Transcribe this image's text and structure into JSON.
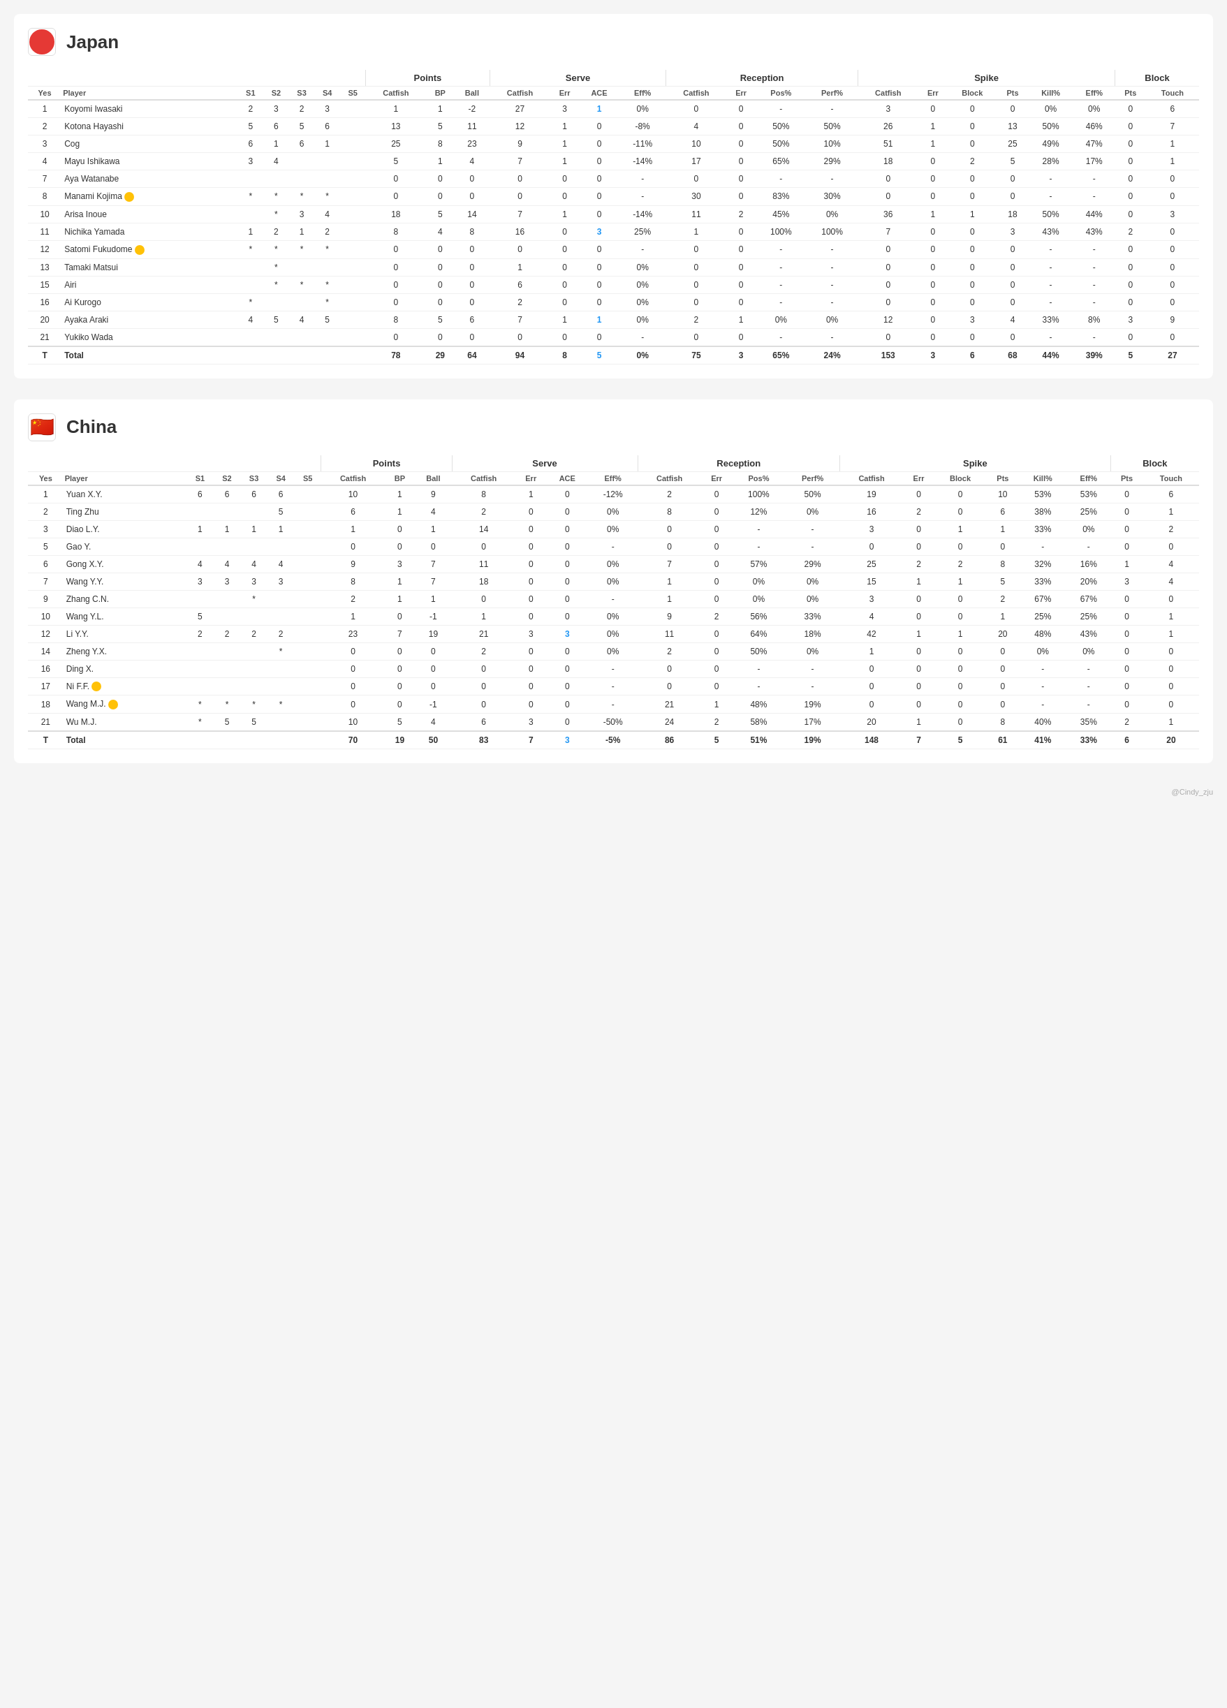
{
  "japan": {
    "name": "Japan",
    "flag": "japan",
    "columns": {
      "yes": "Yes",
      "player": "Player",
      "s1": "S1",
      "s2": "S2",
      "s3": "S3",
      "s4": "S4",
      "s5": "S5",
      "points_catfish": "Catfish",
      "points_bp": "BP",
      "points_ball": "Ball",
      "serve_catfish": "Catfish",
      "serve_err": "Err",
      "serve_ace": "ACE",
      "serve_eff": "Eff%",
      "reception_catfish": "Catfish",
      "reception_err": "Err",
      "reception_pos": "Pos%",
      "reception_perf": "Perf%",
      "spike_catfish": "Catfish",
      "spike_err": "Err",
      "spike_block": "Block",
      "spike_pts": "Pts",
      "spike_kill": "Kill%",
      "spike_eff": "Eff%",
      "block_pts": "Pts",
      "block_touch": "Touch"
    },
    "group_labels": {
      "points": "Points",
      "serve": "Serve",
      "reception": "Reception",
      "spike": "Spike",
      "block": "Block"
    },
    "players": [
      {
        "yes": "1",
        "player": "Koyomi Iwasaki",
        "badge": "",
        "s1": "2",
        "s2": "3",
        "s3": "2",
        "s4": "3",
        "s5": "",
        "pc": "1",
        "bp": "1",
        "ball": "-2",
        "sc": "27",
        "se": "3",
        "ace": "1",
        "seff": "0%",
        "rc": "0",
        "re": "0",
        "rpos": "-",
        "rperf": "-",
        "spc": "3",
        "spe": "0",
        "spblock": "0",
        "sppts": "0",
        "spkill": "0%",
        "speff": "0%",
        "bpts": "0",
        "btouch": "6"
      },
      {
        "yes": "2",
        "player": "Kotona Hayashi",
        "badge": "",
        "s1": "5",
        "s2": "6",
        "s3": "5",
        "s4": "6",
        "s5": "",
        "pc": "13",
        "bp": "5",
        "ball": "11",
        "sc": "12",
        "se": "1",
        "ace": "0",
        "seff": "-8%",
        "rc": "4",
        "re": "0",
        "rpos": "50%",
        "rperf": "50%",
        "spc": "26",
        "spe": "1",
        "spblock": "0",
        "sppts": "13",
        "spkill": "50%",
        "speff": "46%",
        "bpts": "0",
        "btouch": "7"
      },
      {
        "yes": "3",
        "player": "Cog",
        "badge": "",
        "s1": "6",
        "s2": "1",
        "s3": "6",
        "s4": "1",
        "s5": "",
        "pc": "25",
        "bp": "8",
        "ball": "23",
        "sc": "9",
        "se": "1",
        "ace": "0",
        "seff": "-11%",
        "rc": "10",
        "re": "0",
        "rpos": "50%",
        "rperf": "10%",
        "spc": "51",
        "spe": "1",
        "spblock": "0",
        "sppts": "25",
        "spkill": "49%",
        "speff": "47%",
        "bpts": "0",
        "btouch": "1"
      },
      {
        "yes": "4",
        "player": "Mayu Ishikawa",
        "badge": "",
        "s1": "3",
        "s2": "4",
        "s3": "",
        "s4": "",
        "s5": "",
        "pc": "5",
        "bp": "1",
        "ball": "4",
        "sc": "7",
        "se": "1",
        "ace": "0",
        "seff": "-14%",
        "rc": "17",
        "re": "0",
        "rpos": "65%",
        "rperf": "29%",
        "spc": "18",
        "spe": "0",
        "spblock": "2",
        "sppts": "5",
        "spkill": "28%",
        "speff": "17%",
        "bpts": "0",
        "btouch": "1"
      },
      {
        "yes": "7",
        "player": "Aya Watanabe",
        "badge": "",
        "s1": "",
        "s2": "",
        "s3": "",
        "s4": "",
        "s5": "",
        "pc": "0",
        "bp": "0",
        "ball": "0",
        "sc": "0",
        "se": "0",
        "ace": "0",
        "seff": "-",
        "rc": "0",
        "re": "0",
        "rpos": "-",
        "rperf": "-",
        "spc": "0",
        "spe": "0",
        "spblock": "0",
        "sppts": "0",
        "spkill": "-",
        "speff": "-",
        "bpts": "0",
        "btouch": "0"
      },
      {
        "yes": "8",
        "player": "Manami Kojima",
        "badge": "L",
        "s1": "*",
        "s2": "*",
        "s3": "*",
        "s4": "*",
        "s5": "",
        "pc": "0",
        "bp": "0",
        "ball": "0",
        "sc": "0",
        "se": "0",
        "ace": "0",
        "seff": "-",
        "rc": "30",
        "re": "0",
        "rpos": "83%",
        "rperf": "30%",
        "spc": "0",
        "spe": "0",
        "spblock": "0",
        "sppts": "0",
        "spkill": "-",
        "speff": "-",
        "bpts": "0",
        "btouch": "0"
      },
      {
        "yes": "10",
        "player": "Arisa Inoue",
        "badge": "",
        "s1": "",
        "s2": "*",
        "s3": "3",
        "s4": "4",
        "s5": "",
        "pc": "18",
        "bp": "5",
        "ball": "14",
        "sc": "7",
        "se": "1",
        "ace": "0",
        "seff": "-14%",
        "rc": "11",
        "re": "2",
        "rpos": "45%",
        "rperf": "0%",
        "spc": "36",
        "spe": "1",
        "spblock": "1",
        "sppts": "18",
        "spkill": "50%",
        "speff": "44%",
        "bpts": "0",
        "btouch": "3"
      },
      {
        "yes": "11",
        "player": "Nichika Yamada",
        "badge": "",
        "s1": "1",
        "s2": "2",
        "s3": "1",
        "s4": "2",
        "s5": "",
        "pc": "8",
        "bp": "4",
        "ball": "8",
        "sc": "16",
        "se": "0",
        "ace": "3",
        "seff": "25%",
        "rc": "1",
        "re": "0",
        "rpos": "100%",
        "rperf": "100%",
        "spc": "7",
        "spe": "0",
        "spblock": "0",
        "sppts": "3",
        "spkill": "43%",
        "speff": "43%",
        "bpts": "2",
        "btouch": "0"
      },
      {
        "yes": "12",
        "player": "Satomi Fukudome",
        "badge": "L",
        "s1": "*",
        "s2": "*",
        "s3": "*",
        "s4": "*",
        "s5": "",
        "pc": "0",
        "bp": "0",
        "ball": "0",
        "sc": "0",
        "se": "0",
        "ace": "0",
        "seff": "-",
        "rc": "0",
        "re": "0",
        "rpos": "-",
        "rperf": "-",
        "spc": "0",
        "spe": "0",
        "spblock": "0",
        "sppts": "0",
        "spkill": "-",
        "speff": "-",
        "bpts": "0",
        "btouch": "0"
      },
      {
        "yes": "13",
        "player": "Tamaki Matsui",
        "badge": "",
        "s1": "",
        "s2": "*",
        "s3": "",
        "s4": "",
        "s5": "",
        "pc": "0",
        "bp": "0",
        "ball": "0",
        "sc": "1",
        "se": "0",
        "ace": "0",
        "seff": "0%",
        "rc": "0",
        "re": "0",
        "rpos": "-",
        "rperf": "-",
        "spc": "0",
        "spe": "0",
        "spblock": "0",
        "sppts": "0",
        "spkill": "-",
        "speff": "-",
        "bpts": "0",
        "btouch": "0"
      },
      {
        "yes": "15",
        "player": "Airi",
        "badge": "",
        "s1": "",
        "s2": "*",
        "s3": "*",
        "s4": "*",
        "s5": "",
        "pc": "0",
        "bp": "0",
        "ball": "0",
        "sc": "6",
        "se": "0",
        "ace": "0",
        "seff": "0%",
        "rc": "0",
        "re": "0",
        "rpos": "-",
        "rperf": "-",
        "spc": "0",
        "spe": "0",
        "spblock": "0",
        "sppts": "0",
        "spkill": "-",
        "speff": "-",
        "bpts": "0",
        "btouch": "0"
      },
      {
        "yes": "16",
        "player": "Ai Kurogo",
        "badge": "",
        "s1": "*",
        "s2": "",
        "s3": "",
        "s4": "*",
        "s5": "",
        "pc": "0",
        "bp": "0",
        "ball": "0",
        "sc": "2",
        "se": "0",
        "ace": "0",
        "seff": "0%",
        "rc": "0",
        "re": "0",
        "rpos": "-",
        "rperf": "-",
        "spc": "0",
        "spe": "0",
        "spblock": "0",
        "sppts": "0",
        "spkill": "-",
        "speff": "-",
        "bpts": "0",
        "btouch": "0"
      },
      {
        "yes": "20",
        "player": "Ayaka Araki",
        "badge": "",
        "s1": "4",
        "s2": "5",
        "s3": "4",
        "s4": "5",
        "s5": "",
        "pc": "8",
        "bp": "5",
        "ball": "6",
        "sc": "7",
        "se": "1",
        "ace": "1",
        "seff": "0%",
        "rc": "2",
        "re": "1",
        "rpos": "0%",
        "rperf": "0%",
        "spc": "12",
        "spe": "0",
        "spblock": "3",
        "sppts": "4",
        "spkill": "33%",
        "speff": "8%",
        "bpts": "3",
        "btouch": "9"
      },
      {
        "yes": "21",
        "player": "Yukiko Wada",
        "badge": "",
        "s1": "",
        "s2": "",
        "s3": "",
        "s4": "",
        "s5": "",
        "pc": "0",
        "bp": "0",
        "ball": "0",
        "sc": "0",
        "se": "0",
        "ace": "0",
        "seff": "-",
        "rc": "0",
        "re": "0",
        "rpos": "-",
        "rperf": "-",
        "spc": "0",
        "spe": "0",
        "spblock": "0",
        "sppts": "0",
        "spkill": "-",
        "speff": "-",
        "bpts": "0",
        "btouch": "0"
      },
      {
        "yes": "T",
        "player": "Total",
        "badge": "",
        "s1": "",
        "s2": "",
        "s3": "",
        "s4": "",
        "s5": "",
        "pc": "78",
        "bp": "29",
        "ball": "64",
        "sc": "94",
        "se": "8",
        "ace": "5",
        "seff": "0%",
        "rc": "75",
        "re": "3",
        "rpos": "65%",
        "rperf": "24%",
        "spc": "153",
        "spe": "3",
        "spblock": "6",
        "sppts": "68",
        "spkill": "44%",
        "speff": "39%",
        "bpts": "5",
        "btouch": "27"
      }
    ]
  },
  "china": {
    "name": "China",
    "flag": "china",
    "players": [
      {
        "yes": "1",
        "player": "Yuan X.Y.",
        "badge": "",
        "s1": "6",
        "s2": "6",
        "s3": "6",
        "s4": "6",
        "s5": "",
        "pc": "10",
        "bp": "1",
        "ball": "9",
        "sc": "8",
        "se": "1",
        "ace": "0",
        "seff": "-12%",
        "rc": "2",
        "re": "0",
        "rpos": "100%",
        "rperf": "50%",
        "spc": "19",
        "spe": "0",
        "spblock": "0",
        "sppts": "10",
        "spkill": "53%",
        "speff": "53%",
        "bpts": "0",
        "btouch": "6"
      },
      {
        "yes": "2",
        "player": "Ting Zhu",
        "badge": "",
        "s1": "",
        "s2": "",
        "s3": "",
        "s4": "5",
        "s5": "",
        "pc": "6",
        "bp": "1",
        "ball": "4",
        "sc": "2",
        "se": "0",
        "ace": "0",
        "seff": "0%",
        "rc": "8",
        "re": "0",
        "rpos": "12%",
        "rperf": "0%",
        "spc": "16",
        "spe": "2",
        "spblock": "0",
        "sppts": "6",
        "spkill": "38%",
        "speff": "25%",
        "bpts": "0",
        "btouch": "1"
      },
      {
        "yes": "3",
        "player": "Diao L.Y.",
        "badge": "",
        "s1": "1",
        "s2": "1",
        "s3": "1",
        "s4": "1",
        "s5": "",
        "pc": "1",
        "bp": "0",
        "ball": "1",
        "sc": "14",
        "se": "0",
        "ace": "0",
        "seff": "0%",
        "rc": "0",
        "re": "0",
        "rpos": "-",
        "rperf": "-",
        "spc": "3",
        "spe": "0",
        "spblock": "1",
        "sppts": "1",
        "spkill": "33%",
        "speff": "0%",
        "bpts": "0",
        "btouch": "2"
      },
      {
        "yes": "5",
        "player": "Gao Y.",
        "badge": "",
        "s1": "",
        "s2": "",
        "s3": "",
        "s4": "",
        "s5": "",
        "pc": "0",
        "bp": "0",
        "ball": "0",
        "sc": "0",
        "se": "0",
        "ace": "0",
        "seff": "-",
        "rc": "0",
        "re": "0",
        "rpos": "-",
        "rperf": "-",
        "spc": "0",
        "spe": "0",
        "spblock": "0",
        "sppts": "0",
        "spkill": "-",
        "speff": "-",
        "bpts": "0",
        "btouch": "0"
      },
      {
        "yes": "6",
        "player": "Gong X.Y.",
        "badge": "",
        "s1": "4",
        "s2": "4",
        "s3": "4",
        "s4": "4",
        "s5": "",
        "pc": "9",
        "bp": "3",
        "ball": "7",
        "sc": "11",
        "se": "0",
        "ace": "0",
        "seff": "0%",
        "rc": "7",
        "re": "0",
        "rpos": "57%",
        "rperf": "29%",
        "spc": "25",
        "spe": "2",
        "spblock": "2",
        "sppts": "8",
        "spkill": "32%",
        "speff": "16%",
        "bpts": "1",
        "btouch": "4"
      },
      {
        "yes": "7",
        "player": "Wang Y.Y.",
        "badge": "",
        "s1": "3",
        "s2": "3",
        "s3": "3",
        "s4": "3",
        "s5": "",
        "pc": "8",
        "bp": "1",
        "ball": "7",
        "sc": "18",
        "se": "0",
        "ace": "0",
        "seff": "0%",
        "rc": "1",
        "re": "0",
        "rpos": "0%",
        "rperf": "0%",
        "spc": "15",
        "spe": "1",
        "spblock": "1",
        "sppts": "5",
        "spkill": "33%",
        "speff": "20%",
        "bpts": "3",
        "btouch": "4"
      },
      {
        "yes": "9",
        "player": "Zhang C.N.",
        "badge": "",
        "s1": "",
        "s2": "",
        "s3": "*",
        "s4": "",
        "s5": "",
        "pc": "2",
        "bp": "1",
        "ball": "1",
        "sc": "0",
        "se": "0",
        "ace": "0",
        "seff": "-",
        "rc": "1",
        "re": "0",
        "rpos": "0%",
        "rperf": "0%",
        "spc": "3",
        "spe": "0",
        "spblock": "0",
        "sppts": "2",
        "spkill": "67%",
        "speff": "67%",
        "bpts": "0",
        "btouch": "0"
      },
      {
        "yes": "10",
        "player": "Wang Y.L.",
        "badge": "",
        "s1": "5",
        "s2": "",
        "s3": "",
        "s4": "",
        "s5": "",
        "pc": "1",
        "bp": "0",
        "ball": "-1",
        "sc": "1",
        "se": "0",
        "ace": "0",
        "seff": "0%",
        "rc": "9",
        "re": "2",
        "rpos": "56%",
        "rperf": "33%",
        "spc": "4",
        "spe": "0",
        "spblock": "0",
        "sppts": "1",
        "spkill": "25%",
        "speff": "25%",
        "bpts": "0",
        "btouch": "1"
      },
      {
        "yes": "12",
        "player": "Li Y.Y.",
        "badge": "",
        "s1": "2",
        "s2": "2",
        "s3": "2",
        "s4": "2",
        "s5": "",
        "pc": "23",
        "bp": "7",
        "ball": "19",
        "sc": "21",
        "se": "3",
        "ace": "3",
        "seff": "0%",
        "rc": "11",
        "re": "0",
        "rpos": "64%",
        "rperf": "18%",
        "spc": "42",
        "spe": "1",
        "spblock": "1",
        "sppts": "20",
        "spkill": "48%",
        "speff": "43%",
        "bpts": "0",
        "btouch": "1"
      },
      {
        "yes": "14",
        "player": "Zheng Y.X.",
        "badge": "",
        "s1": "",
        "s2": "",
        "s3": "",
        "s4": "*",
        "s5": "",
        "pc": "0",
        "bp": "0",
        "ball": "0",
        "sc": "2",
        "se": "0",
        "ace": "0",
        "seff": "0%",
        "rc": "2",
        "re": "0",
        "rpos": "50%",
        "rperf": "0%",
        "spc": "1",
        "spe": "0",
        "spblock": "0",
        "sppts": "0",
        "spkill": "0%",
        "speff": "0%",
        "bpts": "0",
        "btouch": "0"
      },
      {
        "yes": "16",
        "player": "Ding X.",
        "badge": "",
        "s1": "",
        "s2": "",
        "s3": "",
        "s4": "",
        "s5": "",
        "pc": "0",
        "bp": "0",
        "ball": "0",
        "sc": "0",
        "se": "0",
        "ace": "0",
        "seff": "-",
        "rc": "0",
        "re": "0",
        "rpos": "-",
        "rperf": "-",
        "spc": "0",
        "spe": "0",
        "spblock": "0",
        "sppts": "0",
        "spkill": "-",
        "speff": "-",
        "bpts": "0",
        "btouch": "0"
      },
      {
        "yes": "17",
        "player": "Ni F.F.",
        "badge": "L",
        "s1": "",
        "s2": "",
        "s3": "",
        "s4": "",
        "s5": "",
        "pc": "0",
        "bp": "0",
        "ball": "0",
        "sc": "0",
        "se": "0",
        "ace": "0",
        "seff": "-",
        "rc": "0",
        "re": "0",
        "rpos": "-",
        "rperf": "-",
        "spc": "0",
        "spe": "0",
        "spblock": "0",
        "sppts": "0",
        "spkill": "-",
        "speff": "-",
        "bpts": "0",
        "btouch": "0"
      },
      {
        "yes": "18",
        "player": "Wang M.J.",
        "badge": "L",
        "s1": "*",
        "s2": "*",
        "s3": "*",
        "s4": "*",
        "s5": "",
        "pc": "0",
        "bp": "0",
        "ball": "-1",
        "sc": "0",
        "se": "0",
        "ace": "0",
        "seff": "-",
        "rc": "21",
        "re": "1",
        "rpos": "48%",
        "rperf": "19%",
        "spc": "0",
        "spe": "0",
        "spblock": "0",
        "sppts": "0",
        "spkill": "-",
        "speff": "-",
        "bpts": "0",
        "btouch": "0"
      },
      {
        "yes": "21",
        "player": "Wu M.J.",
        "badge": "",
        "s1": "*",
        "s2": "5",
        "s3": "5",
        "s4": "",
        "s5": "",
        "pc": "10",
        "bp": "5",
        "ball": "4",
        "sc": "6",
        "se": "3",
        "ace": "0",
        "seff": "-50%",
        "rc": "24",
        "re": "2",
        "rpos": "58%",
        "rperf": "17%",
        "spc": "20",
        "spe": "1",
        "spblock": "0",
        "sppts": "8",
        "spkill": "40%",
        "speff": "35%",
        "bpts": "2",
        "btouch": "1"
      },
      {
        "yes": "T",
        "player": "Total",
        "badge": "",
        "s1": "",
        "s2": "",
        "s3": "",
        "s4": "",
        "s5": "",
        "pc": "70",
        "bp": "19",
        "ball": "50",
        "sc": "83",
        "se": "7",
        "ace": "3",
        "seff": "-5%",
        "rc": "86",
        "re": "5",
        "rpos": "51%",
        "rperf": "19%",
        "spc": "148",
        "spe": "7",
        "spblock": "5",
        "sppts": "61",
        "spkill": "41%",
        "speff": "33%",
        "bpts": "6",
        "btouch": "20"
      }
    ]
  },
  "watermark": "@Cindy_zju"
}
